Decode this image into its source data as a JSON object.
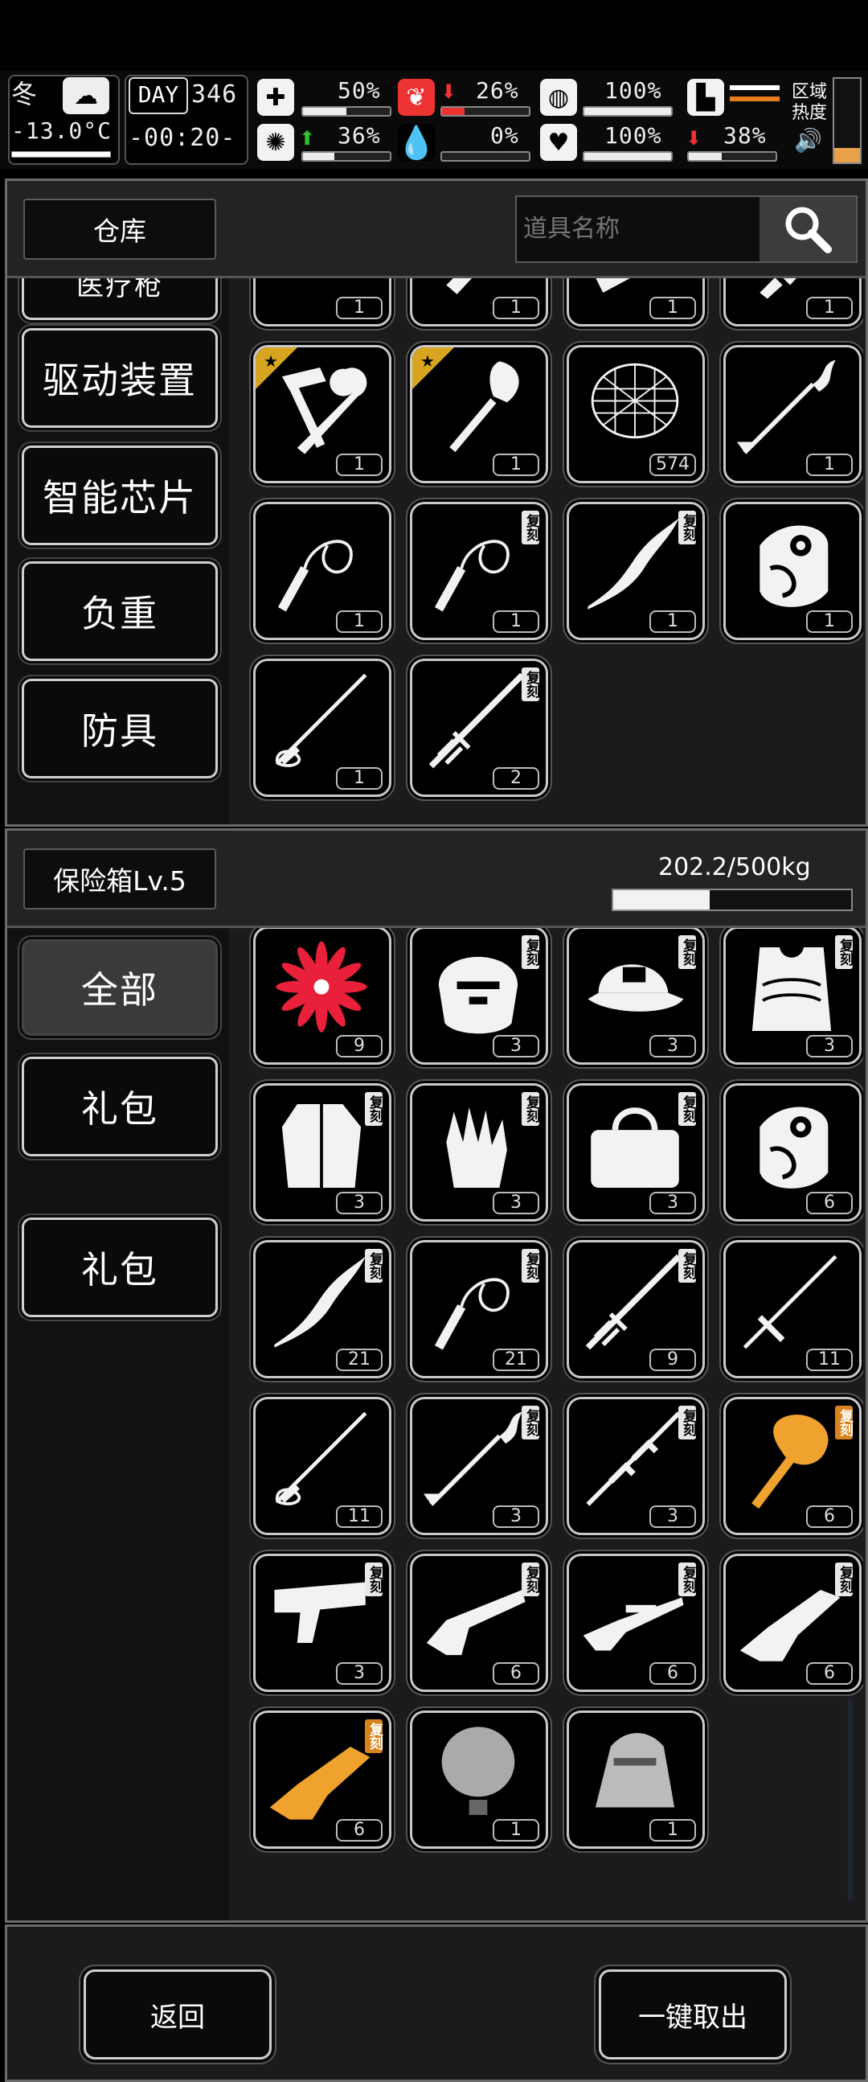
{
  "hud": {
    "season": "冬",
    "temperature": "-13.0°C",
    "day_label": "DAY",
    "day_value": "346",
    "time": "-00:20-",
    "stats": [
      {
        "name": "medical",
        "value": "50%",
        "level": 0.5
      },
      {
        "name": "hunger",
        "value": "26%",
        "level": 0.26,
        "trend": "down"
      },
      {
        "name": "water",
        "value": "100%",
        "level": 1.0
      },
      {
        "name": "mood",
        "value": "36%",
        "level": 0.36,
        "trend": "up"
      },
      {
        "name": "blood",
        "value": "0%",
        "level": 0.0
      },
      {
        "name": "health",
        "value": "100%",
        "level": 1.0
      },
      {
        "name": "stamina",
        "value": "38%",
        "level": 0.38,
        "trend": "down"
      }
    ],
    "region_label_1": "区域",
    "region_label_2": "热度",
    "colors": {
      "accent_red": "#e33333",
      "accent_green": "#2fbf2f",
      "heat_orange": "#e77e1d"
    }
  },
  "warehouse": {
    "title": "仓库",
    "search_placeholder": "道具名称",
    "categories": [
      {
        "label": "医疗枪"
      },
      {
        "label": "驱动装置"
      },
      {
        "label": "智能芯片"
      },
      {
        "label": "负重"
      },
      {
        "label": "防具"
      }
    ],
    "items": [
      {
        "icon": "medical-gun-icon",
        "count": "1"
      },
      {
        "icon": "knife-icon",
        "count": "1"
      },
      {
        "icon": "dagger-icon",
        "count": "1"
      },
      {
        "icon": "cleaver-icon",
        "count": "1"
      },
      {
        "icon": "hammer-wrench-icon",
        "count": "1",
        "starred": true
      },
      {
        "icon": "shovel-icon",
        "count": "1",
        "starred": true
      },
      {
        "icon": "net-icon",
        "count": "574"
      },
      {
        "icon": "spear-icon",
        "count": "1"
      },
      {
        "icon": "whip-icon",
        "count": "1"
      },
      {
        "icon": "whip-icon",
        "count": "1",
        "tag": "复刻"
      },
      {
        "icon": "serpent-blade-icon",
        "count": "1",
        "tag": "复刻"
      },
      {
        "icon": "gauntlet-icon",
        "count": "1"
      },
      {
        "icon": "katana-icon",
        "count": "1"
      },
      {
        "icon": "ornate-sword-icon",
        "count": "2",
        "tag": "复刻"
      }
    ]
  },
  "safebox": {
    "title": "保险箱Lv.5",
    "capacity_text": "202.2/500kg",
    "capacity_level": 0.4044,
    "categories": [
      {
        "label": "全部",
        "active": true
      },
      {
        "label": "礼包"
      },
      {
        "label": "礼包"
      }
    ],
    "items": [
      {
        "icon": "red-flower-icon",
        "count": "9"
      },
      {
        "icon": "demon-helmet-icon",
        "count": "3",
        "tag": "复刻"
      },
      {
        "icon": "cap-icon",
        "count": "3",
        "tag": "复刻"
      },
      {
        "icon": "armor-vest-icon",
        "count": "3",
        "tag": "复刻"
      },
      {
        "icon": "coat-icon",
        "count": "3",
        "tag": "复刻"
      },
      {
        "icon": "glove-icon",
        "count": "3",
        "tag": "复刻"
      },
      {
        "icon": "bag-icon",
        "count": "3",
        "tag": "复刻"
      },
      {
        "icon": "gauntlet-icon",
        "count": "6"
      },
      {
        "icon": "serpent-blade-icon",
        "count": "21",
        "tag": "复刻"
      },
      {
        "icon": "whip-icon",
        "count": "21",
        "tag": "复刻"
      },
      {
        "icon": "ornate-sword-icon",
        "count": "9",
        "tag": "复刻"
      },
      {
        "icon": "cross-sword-icon",
        "count": "11"
      },
      {
        "icon": "katana-icon",
        "count": "11"
      },
      {
        "icon": "spear-icon",
        "count": "3",
        "tag": "复刻"
      },
      {
        "icon": "halberd-icon",
        "count": "3",
        "tag": "复刻"
      },
      {
        "icon": "golden-mace-icon",
        "count": "6",
        "tag": "复刻",
        "gold": true
      },
      {
        "icon": "ornate-pistol-icon",
        "count": "3",
        "tag": "复刻"
      },
      {
        "icon": "ornate-rifle-icon",
        "count": "6",
        "tag": "复刻"
      },
      {
        "icon": "sniper-rifle-icon",
        "count": "6",
        "tag": "复刻"
      },
      {
        "icon": "heavy-gun-icon",
        "count": "6",
        "tag": "复刻"
      },
      {
        "icon": "golden-gun-icon",
        "count": "6",
        "tag": "复刻",
        "gold": true
      },
      {
        "icon": "hot-air-balloon-icon",
        "count": "1"
      },
      {
        "icon": "car-icon",
        "count": "1"
      }
    ]
  },
  "footer": {
    "back_label": "返回",
    "take_all_label": "一键取出"
  }
}
